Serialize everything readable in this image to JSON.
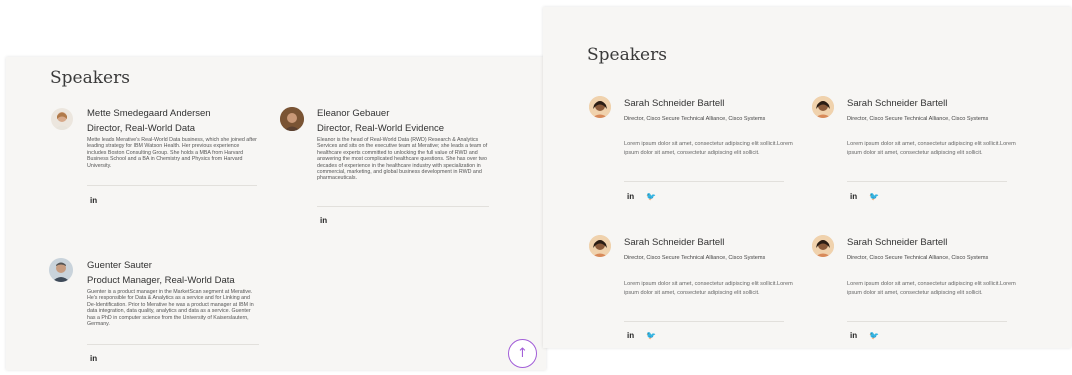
{
  "left": {
    "title": "Speakers",
    "speakers": [
      {
        "name": "Mette Smedegaard Andersen",
        "role": "Director, Real-World Data",
        "bio": "Mette leads Merative's Real-World Data business, which she joined after leading strategy for IBM Watson Health. Her previous experience includes Boston Consulting Group. She holds a MBA from Harvard Business School and a BA in Chemistry and Physics from Harvard University.",
        "social": "in"
      },
      {
        "name": "Eleanor Gebauer",
        "role": "Director, Real-World Evidence",
        "bio": "Eleanor is the head of Real-World Data (RWD) Research & Analytics Services and sits on the executive team at Merative; she leads a team of healthcare experts committed to unlocking the full value of RWD and answering the most complicated healthcare questions. She has over two decades of experience in the healthcare industry with specialization in commercial, marketing, and global business development in RWD and pharmaceuticals.",
        "social": "in"
      },
      {
        "name": "Guenter Sauter",
        "role": "Product Manager, Real-World Data",
        "bio": "Guenter is a product manager in the MarketScan segment at Merative. He's responsible for Data & Analytics as a service and for Linking and De-Identification. Prior to Merative he was a product manager at IBM in data integration, data quality, analytics and data as a service. Guenter has a PhD in computer science from the University of Kaiserslautern, Germany.",
        "social": "in"
      }
    ]
  },
  "right": {
    "title": "Speakers",
    "cards": [
      {
        "name": "Sarah Schneider Bartell",
        "role": "Director, Cisco Secure Technical Alliance, Cisco Systems",
        "bio": "Lorem ipsum dolor sit amet, consectetur adipiscing elit sollicit.Lorem ipsum dolor sit amet, consectetur adipiscing elit sollicit.",
        "linkedin": "in",
        "twitter": "🐦"
      },
      {
        "name": "Sarah Schneider Bartell",
        "role": "Director, Cisco Secure Technical Alliance, Cisco Systems",
        "bio": "Lorem ipsum dolor sit amet, consectetur adipiscing elit sollicit.Lorem ipsum dolor sit amet, consectetur adipiscing elit sollicit.",
        "linkedin": "in",
        "twitter": "🐦"
      },
      {
        "name": "Sarah Schneider Bartell",
        "role": "Director, Cisco Secure Technical Alliance, Cisco Systems",
        "bio": "Lorem ipsum dolor sit amet, consectetur adipiscing elit sollicit.Lorem ipsum dolor sit amet, consectetur adipiscing elit sollicit.",
        "linkedin": "in",
        "twitter": "🐦"
      },
      {
        "name": "Sarah Schneider Bartell",
        "role": "Director, Cisco Secure Technical Alliance, Cisco Systems",
        "bio": "Lorem ipsum dolor sit amet, consectetur adipiscing elit sollicit.Lorem ipsum dolor sit amet, consectetur adipiscing elit sollicit.",
        "linkedin": "in",
        "twitter": "🐦"
      }
    ]
  },
  "scroll_top": {
    "icon": "↑",
    "accent": "#a25ed8"
  }
}
